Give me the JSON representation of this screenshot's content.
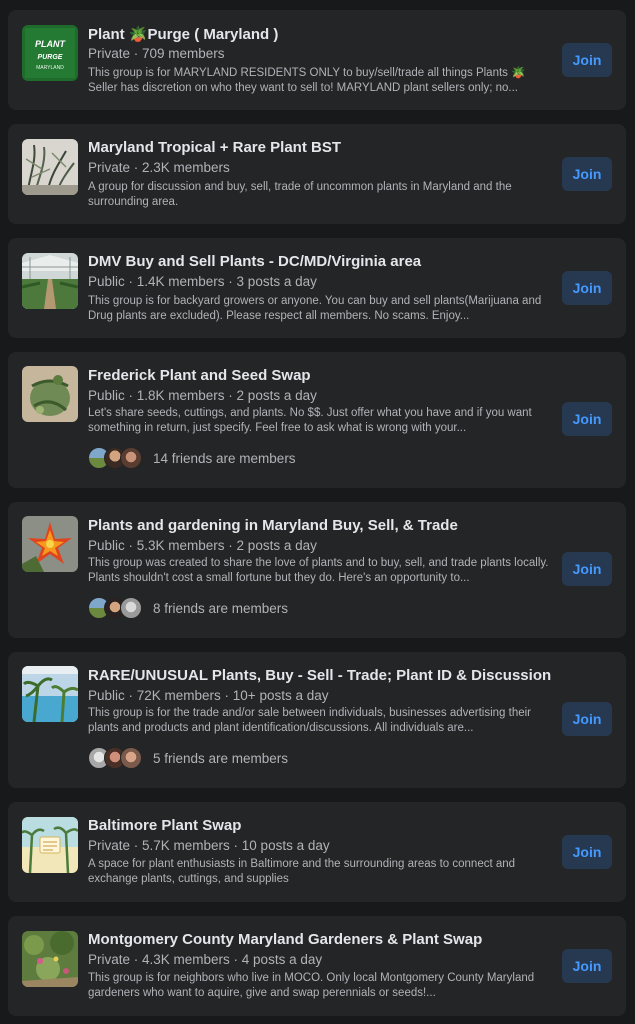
{
  "groups": [
    {
      "title": "Plant 🪴Purge ( Maryland )",
      "meta": "Private · 709 members",
      "description": "This group is for MARYLAND RESIDENTS ONLY to buy/sell/trade all things Plants 🪴 Seller has discretion on who they want to sell to! MARYLAND plant sellers only; no...",
      "thumb_text": [
        "PLANT",
        "PURGE",
        "MARYLAND"
      ],
      "join": "Join"
    },
    {
      "title": "Maryland Tropical + Rare Plant BST",
      "meta": "Private · 2.3K members",
      "description": "A group for discussion and buy, sell, trade of uncommon plants in Maryland and the surrounding area.",
      "join": "Join"
    },
    {
      "title": "DMV Buy and Sell Plants - DC/MD/Virginia area",
      "meta": "Public · 1.4K members · 3 posts a day",
      "description": "This group is for backyard growers or anyone. You can buy and sell plants(Marijuana and Drug plants are excluded). Please respect all members. No scams. Enjoy...",
      "join": "Join"
    },
    {
      "title": "Frederick Plant and Seed Swap",
      "meta": "Public · 1.8K members · 2 posts a day",
      "description": "Let's share seeds, cuttings, and plants. No $$. Just offer what you have and if you want something in return, just specify. Feel free to ask what is wrong with your...",
      "friends": "14 friends are members",
      "join": "Join"
    },
    {
      "title": "Plants and gardening in Maryland Buy, Sell, & Trade",
      "meta": "Public · 5.3K members · 2 posts a day",
      "description": "This group was created to share the love of plants and to buy, sell, and trade plants locally. Plants shouldn't cost a small fortune but they do. Here's an opportunity to...",
      "friends": "8 friends are members",
      "join": "Join"
    },
    {
      "title": "RARE/UNUSUAL Plants, Buy - Sell - Trade; Plant ID & Discussion",
      "meta": "Public · 72K members · 10+ posts a day",
      "description": "This group is for the trade and/or sale between individuals, businesses advertising their plants and products and plant identification/discussions. All individuals are...",
      "friends": "5 friends are members",
      "join": "Join"
    },
    {
      "title": "Baltimore Plant Swap",
      "meta": "Private · 5.7K members · 10 posts a day",
      "description": "A space for plant enthusiasts in Baltimore and the surrounding areas to connect and exchange plants, cuttings, and supplies",
      "join": "Join"
    },
    {
      "title": "Montgomery County Maryland Gardeners & Plant Swap",
      "meta": "Private · 4.3K members · 4 posts a day",
      "description": "This group is for neighbors who live in MOCO. Only local Montgomery County Maryland gardeners who want to aquire, give and swap perennials or seeds!...",
      "join": "Join"
    }
  ]
}
